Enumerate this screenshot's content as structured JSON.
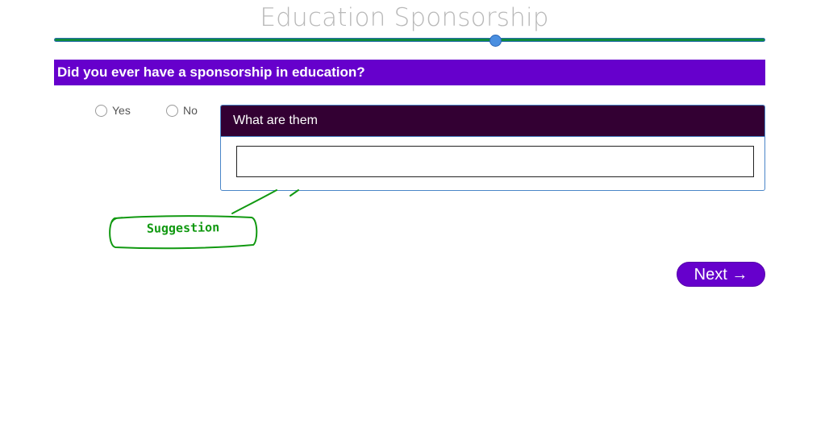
{
  "header": {
    "title": "Education Sponsorship"
  },
  "progress": {
    "value_fraction": 0.62
  },
  "question": {
    "text": "Did you ever have a sponsorship in education?"
  },
  "options": [
    {
      "label": "Yes",
      "selected": false
    },
    {
      "label": "No",
      "selected": false
    }
  ],
  "followup_panel": {
    "title": "What are them",
    "input_value": "",
    "input_placeholder": ""
  },
  "annotation": {
    "label": "Suggestion",
    "color": "#119911"
  },
  "navigation": {
    "next_label": "Next →"
  },
  "colors": {
    "accent": "#6600cc",
    "panel_header": "#330033",
    "progress_track": "#0e8a3e",
    "progress_thumb": "#4a8fe0"
  }
}
